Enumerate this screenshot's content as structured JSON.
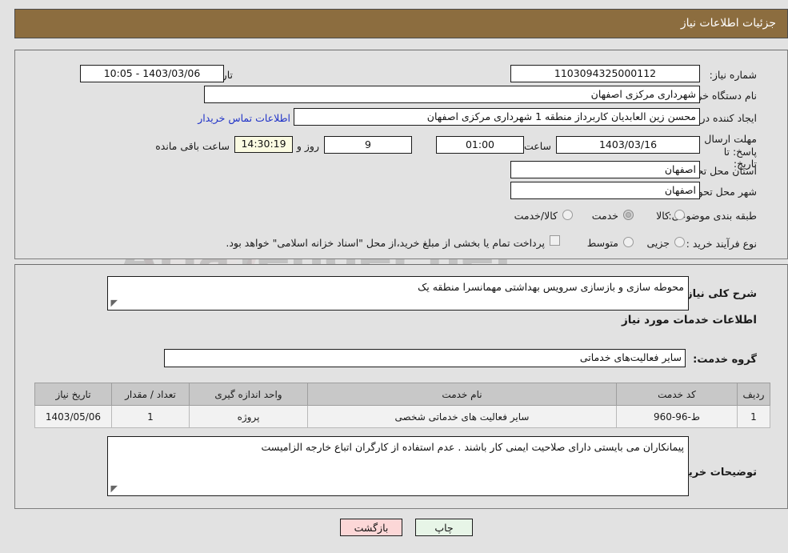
{
  "header": {
    "title": "جزئیات اطلاعات نیاز"
  },
  "form": {
    "need_number_label": "شماره نیاز:",
    "need_number_value": "1103094325000112",
    "buyer_org_label": "نام دستگاه خریدار:",
    "buyer_org_value": "شهرداری مرکزی اصفهان",
    "request_creator_label": "ایجاد کننده درخواست:",
    "request_creator_value": "محسن زین العابدیان کاربرداز منطقه 1 شهرداری مرکزی اصفهان",
    "deadline_label": "مهلت ارسال پاسخ: تا تاریخ:",
    "deadline_date": "1403/03/16",
    "hour_label": "ساعت",
    "deadline_time": "01:00",
    "days_remaining": "9",
    "days_label": "روز و",
    "time_remaining": "14:30:19",
    "remaining_suffix": "ساعت باقی مانده",
    "announce_label": "تاریخ و ساعت اعلان عمومی:",
    "announce_value": "1403/03/06 - 10:05",
    "empty_field_value": "",
    "contact_link": "اطلاعات تماس خریدار",
    "province_label": "استان محل تحویل:",
    "province_value": "اصفهان",
    "city_label": "شهر محل تحویل:",
    "city_value": "اصفهان",
    "classification_label": "طبقه بندی موضوعی:",
    "classification_options": [
      "کالا",
      "خدمت",
      "کالا/خدمت"
    ],
    "classification_selected": "خدمت",
    "purchase_type_label": "نوع فرآیند خرید :",
    "purchase_type_options": [
      "جزیی",
      "متوسط"
    ],
    "purchase_type_selected": "",
    "treasury_checkbox_label": "پرداخت تمام یا بخشی از مبلغ خرید،از محل \"اسناد خزانه اسلامی\" خواهد بود.",
    "treasury_checked": false
  },
  "summary": {
    "label": "شرح کلی نیاز:",
    "value": "محوطه سازی و بازسازی سرویس بهداشتی مهمانسرا منطقه یک"
  },
  "services": {
    "section_title": "اطلاعات خدمات مورد نیاز",
    "group_label": "گروه خدمت:",
    "group_value": "سایر فعالیت‌های خدماتی",
    "columns": [
      "ردیف",
      "کد خدمت",
      "نام خدمت",
      "واحد اندازه گیری",
      "تعداد / مقدار",
      "تاریخ نیاز"
    ],
    "rows": [
      {
        "row": "1",
        "code": "ط-96-960",
        "name": "سایر فعالیت های خدماتی شخصی",
        "unit": "پروژه",
        "quantity": "1",
        "date": "1403/05/06"
      }
    ]
  },
  "notes": {
    "label": "توضیحات خریدار:",
    "value": "پیمانکاران می بایستی دارای صلاحیت ایمنی کار باشند . عدم استفاده از کارگران اتباع خارجه الزامیست"
  },
  "actions": {
    "print_label": "چاپ",
    "back_label": "بازگشت"
  },
  "colors": {
    "header_bar": "#8c6d3f",
    "page_background": "#e2e2e2",
    "link": "#2033c8",
    "table_header": "#c8c8c8",
    "print_button": "#e7f5e7",
    "back_button": "#fcd7d7",
    "highlight_field": "#fbfbe2"
  },
  "watermark": {
    "text": "AriaTender.net"
  }
}
